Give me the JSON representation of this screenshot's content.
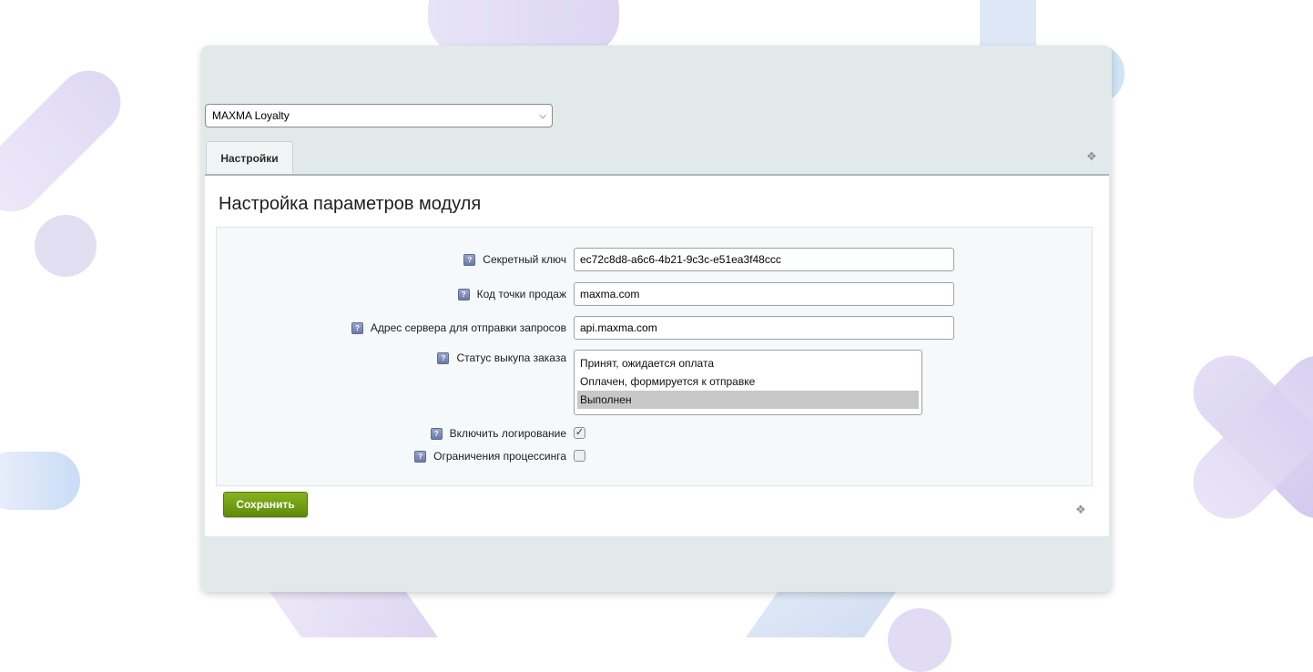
{
  "module_select": {
    "value": "MAXMA Loyalty"
  },
  "tabs": [
    {
      "label": "Настройки"
    }
  ],
  "panel": {
    "title": "Настройка параметров модуля"
  },
  "form": {
    "secret_key": {
      "label": "Секретный ключ",
      "value": "ec72c8d8-a6c6-4b21-9c3c-e51ea3f48ccc"
    },
    "pos_code": {
      "label": "Код точки продаж",
      "value": "maxma.com"
    },
    "server_address": {
      "label": "Адрес сервера для отправки запросов",
      "value": "api.maxma.com"
    },
    "order_status": {
      "label": "Статус выкупа заказа",
      "options": [
        "Принят, ожидается оплата",
        "Оплачен, формируется к отправке",
        "Выполнен"
      ],
      "selected": "Выполнен"
    },
    "enable_logging": {
      "label": "Включить логирование",
      "checked": true
    },
    "processing_limits": {
      "label": "Ограничения процессинга",
      "checked": false
    }
  },
  "buttons": {
    "save_label": "Сохранить"
  },
  "icons": {
    "help": "help-icon",
    "pin": "pin-icon",
    "chevron": "chevron-down-icon"
  },
  "colors": {
    "save_button": "#6f9e12",
    "window_bg": "#e1e9eb",
    "selected_option": "#c8c8c8"
  }
}
